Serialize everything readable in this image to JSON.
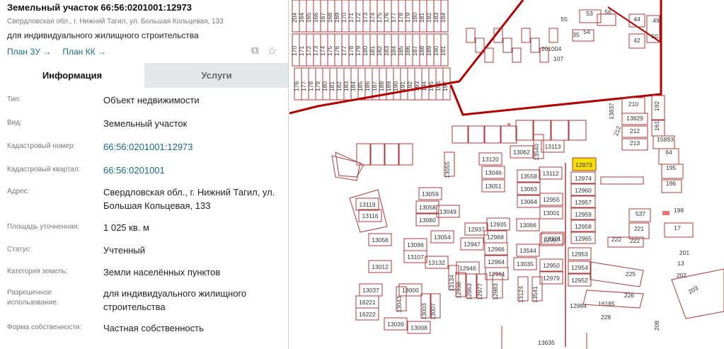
{
  "header": {
    "title": "Земельный участок 66:56:0201001:12973",
    "address": "Свердловская обл., г. Нижний Тагил, ул. Большая Кольцевая, 133",
    "purpose": "для индивидуального жилищного строительства",
    "plan_zu": "План ЗУ →",
    "plan_kk": "План КК →"
  },
  "tools": {
    "layers_icon": "layers-icon",
    "star_icon": "star-icon"
  },
  "tabs": [
    {
      "label": "Информация"
    },
    {
      "label": "Услуги"
    }
  ],
  "info": [
    {
      "label": "Тип:",
      "value": "Объект недвижимости"
    },
    {
      "label": "Вид:",
      "value": "Земельный участок"
    },
    {
      "label": "Кадастровый номер:",
      "value": "66:56:0201001:12973"
    },
    {
      "label": "Кадастровый квартал:",
      "value": "66:56:0201001"
    },
    {
      "label": "Адрес:",
      "value": "Свердловская обл., г. Нижний Тагил, ул. Большая Кольцевая, 133"
    },
    {
      "label": "Площадь уточненная:",
      "value": "1 025 кв. м"
    },
    {
      "label": "Статус:",
      "value": "Учтенный"
    },
    {
      "label": "Категория земель:",
      "value": "Земли населённых пунктов"
    },
    {
      "label": "Разрешенное использование:",
      "value": "для индивидуального жилищного строительства"
    },
    {
      "label": "Форма собственности:",
      "value": "Частная собственность"
    }
  ],
  "map": {
    "highlight": "12973",
    "quarter": "201004",
    "parcels": [
      "55",
      "53",
      "56",
      "54",
      "35",
      "107",
      "44",
      "42",
      "49",
      "50",
      "210",
      "13837",
      "13829",
      "212",
      "213",
      "192",
      "161",
      "15893",
      "64",
      "195",
      "196",
      "198",
      "537",
      "221",
      "17",
      "222",
      "222",
      "201",
      "13",
      "202",
      "203",
      "225",
      "226",
      "228",
      "208",
      "16185",
      "12984",
      "13635",
      "13120",
      "13046",
      "13051",
      "13062",
      "13540",
      "13113",
      "13558",
      "13063",
      "13064",
      "13112",
      "12955",
      "13001",
      "12974",
      "12960",
      "12957",
      "12959",
      "12958",
      "12965",
      "13055",
      "13059",
      "13058",
      "13060",
      "13049",
      "13119",
      "13116",
      "12935",
      "12937",
      "12947",
      "12968",
      "12966",
      "12964",
      "12961",
      "12946",
      "12938",
      "12963",
      "12977",
      "12983",
      "13066",
      "13101",
      "13544",
      "13035",
      "13124",
      "13541",
      "12997",
      "12950",
      "12979",
      "12953",
      "12954",
      "12952",
      "13056",
      "13012",
      "13096",
      "13107",
      "13132",
      "13054",
      "13134",
      "13037",
      "16221",
      "16222",
      "13043",
      "13039",
      "13008",
      "13003",
      "13007"
    ],
    "top_parcels": [
      "204",
      "164",
      "165",
      "166",
      "167",
      "168",
      "169",
      "170",
      "171",
      "172",
      "173",
      "174",
      "175",
      "176",
      "177",
      "178",
      "179",
      "180",
      "181",
      "182",
      "183",
      "184",
      "185",
      "186",
      "187",
      "188",
      "189",
      "190",
      "191",
      "192",
      "193",
      "194",
      "195",
      "196",
      "197",
      "198",
      "199",
      "200",
      "201",
      "202",
      "203",
      "205",
      "206",
      "207",
      "208",
      "209"
    ],
    "colors": {
      "boundary": "#b00000",
      "parcel": "#a83a3a",
      "highlight": "#f7e000"
    }
  }
}
